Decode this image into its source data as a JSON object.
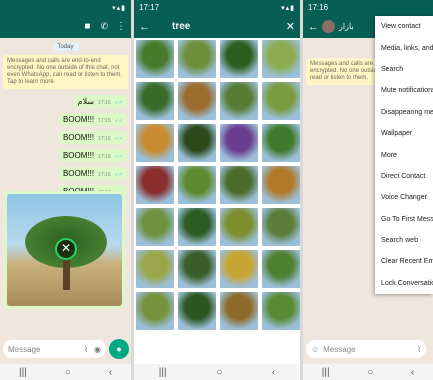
{
  "chat_panel": {
    "status_time": "",
    "date_label": "Today",
    "encryption_notice": "Messages and calls are end-to-end encrypted. No one outside of this chat, not even WhatsApp, can read or listen to them. Tap to learn more.",
    "messages": [
      {
        "text": "سلام",
        "time": "17:15"
      },
      {
        "text": "BOOM!!!",
        "time": "17:15"
      },
      {
        "text": "BOOM!!!",
        "time": "17:16"
      },
      {
        "text": "BOOM!!!",
        "time": "17:16"
      },
      {
        "text": "BOOM!!!",
        "time": "17:16"
      },
      {
        "text": "BOOM!!!",
        "time": "17:16"
      }
    ],
    "compose_placeholder": "Message"
  },
  "search_panel": {
    "status_time": "17:17",
    "query": "tree"
  },
  "menu_panel": {
    "status_time": "17:16",
    "contact_name": "بازار",
    "encryption_notice": "Messages and calls are end-to-end encrypted. No one outside of this chat can read or listen to them.",
    "compose_placeholder": "Message",
    "menu_items": [
      "View contact",
      "Media, links, and docs",
      "Search",
      "Mute notifications",
      "Disappearing messages",
      "Wallpaper",
      "More",
      "Direct Contact",
      "Voice Changer",
      "Go To First Message",
      "Search web",
      "Clear Recent Emojis",
      "Lock Conversation"
    ]
  },
  "colors": {
    "header": "#075e54",
    "bubble": "#dcf8c6",
    "accent": "#00a884"
  },
  "icons": {
    "back": "arrow-left-icon",
    "close": "close-icon",
    "video": "video-call-icon",
    "call": "phone-icon",
    "more": "more-vertical-icon",
    "attach": "paperclip-icon",
    "camera": "camera-icon",
    "mic": "mic-icon",
    "emoji": "emoji-icon"
  }
}
